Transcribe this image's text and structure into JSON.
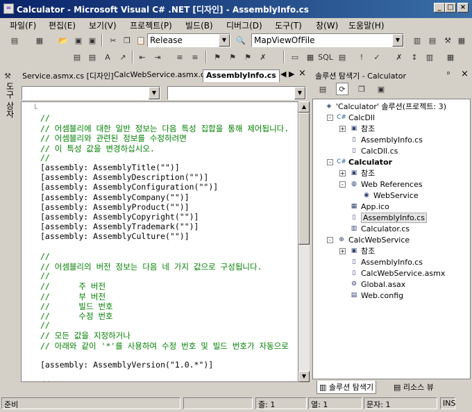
{
  "window": {
    "title": "Calculator - Microsoft Visual C# .NET [디자인] - AssemblyInfo.cs",
    "min": "_",
    "max": "□",
    "close": "×"
  },
  "menu": [
    "파일(F)",
    "편집(E)",
    "보기(V)",
    "프로젝트(P)",
    "빌드(B)",
    "디버그(D)",
    "도구(T)",
    "창(W)",
    "도움말(H)"
  ],
  "toolbar": {
    "config": "Release",
    "find": "MapViewOfFile"
  },
  "toolbox": {
    "label": "도구 상자"
  },
  "editor": {
    "tabs": [
      "Service.asmx.cs [디자인]",
      "CalcWebService.asmx.cs",
      "AssemblyInfo.cs"
    ],
    "lines": [
      {
        "t": "//",
        "c": true
      },
      {
        "t": "// 어셈블리에 대한 일반 정보는 다음 특성 집합을 통해 제어됩니다.",
        "c": true
      },
      {
        "t": "// 어셈블리와 관련된 정보를 수정하려면",
        "c": true
      },
      {
        "t": "// 이 특성 값을 변경하십시오.",
        "c": true
      },
      {
        "t": "//",
        "c": true
      },
      {
        "t": "[assembly: AssemblyTitle(\"\")]",
        "c": false
      },
      {
        "t": "[assembly: AssemblyDescription(\"\")]",
        "c": false
      },
      {
        "t": "[assembly: AssemblyConfiguration(\"\")]",
        "c": false
      },
      {
        "t": "[assembly: AssemblyCompany(\"\")]",
        "c": false
      },
      {
        "t": "[assembly: AssemblyProduct(\"\")]",
        "c": false
      },
      {
        "t": "[assembly: AssemblyCopyright(\"\")]",
        "c": false
      },
      {
        "t": "[assembly: AssemblyTrademark(\"\")]",
        "c": false
      },
      {
        "t": "[assembly: AssemblyCulture(\"\")]",
        "c": false
      },
      {
        "t": "",
        "c": false
      },
      {
        "t": "//",
        "c": true
      },
      {
        "t": "// 어셈블리의 버전 정보는 다음 네 가지 값으로 구성됩니다.",
        "c": true
      },
      {
        "t": "//",
        "c": true
      },
      {
        "t": "//      주 버전",
        "c": true
      },
      {
        "t": "//      부 버전",
        "c": true
      },
      {
        "t": "//      빌드 번호",
        "c": true
      },
      {
        "t": "//      수정 번호",
        "c": true
      },
      {
        "t": "//",
        "c": true
      },
      {
        "t": "// 모든 값을 지정하거나",
        "c": true
      },
      {
        "t": "// 아래와 같이 '*'를 사용하여 수정 번호 및 빌드 번호가 자동으로",
        "c": true
      },
      {
        "t": "",
        "c": false
      },
      {
        "t": "[assembly: AssemblyVersion(\"1.0.*\")]",
        "c": false
      },
      {
        "t": "",
        "c": false
      },
      {
        "t": "//",
        "c": true
      }
    ]
  },
  "solution_explorer": {
    "title": "솔루션 탐색기 - Calculator",
    "pin": "ᵖ",
    "close": "×",
    "nodes": [
      {
        "label": "'Calculator' 솔루션(프로젝트: 3)",
        "icon": "solution-icon",
        "lvl": 0,
        "pm": "",
        "bold": false
      },
      {
        "label": "CalcDll",
        "icon": "csharp-project-icon",
        "lvl": 1,
        "pm": "-",
        "bold": false
      },
      {
        "label": "참조",
        "icon": "references-icon",
        "lvl": 2,
        "pm": "+",
        "bold": false
      },
      {
        "label": "AssemblyInfo.cs",
        "icon": "cs-file-icon",
        "lvl": 2,
        "pm": "",
        "bold": false
      },
      {
        "label": "CalcDll.cs",
        "icon": "cs-file-icon",
        "lvl": 2,
        "pm": "",
        "bold": false
      },
      {
        "label": "Calculator",
        "icon": "csharp-project-icon",
        "lvl": 1,
        "pm": "-",
        "bold": true
      },
      {
        "label": "참조",
        "icon": "references-icon",
        "lvl": 2,
        "pm": "+",
        "bold": false
      },
      {
        "label": "Web References",
        "icon": "web-references-icon",
        "lvl": 2,
        "pm": "-",
        "bold": false
      },
      {
        "label": "WebService",
        "icon": "web-service-icon",
        "lvl": 3,
        "pm": "",
        "bold": false
      },
      {
        "label": "App.ico",
        "icon": "ico-file-icon",
        "lvl": 2,
        "pm": "",
        "bold": false
      },
      {
        "label": "AssemblyInfo.cs",
        "icon": "cs-file-icon",
        "lvl": 2,
        "pm": "",
        "bold": false,
        "selected": true
      },
      {
        "label": "Calculator.cs",
        "icon": "form-file-icon",
        "lvl": 2,
        "pm": "",
        "bold": false
      },
      {
        "label": "CalcWebService",
        "icon": "web-project-icon",
        "lvl": 1,
        "pm": "-",
        "bold": false
      },
      {
        "label": "참조",
        "icon": "references-icon",
        "lvl": 2,
        "pm": "+",
        "bold": false
      },
      {
        "label": "AssemblyInfo.cs",
        "icon": "cs-file-icon",
        "lvl": 2,
        "pm": "",
        "bold": false
      },
      {
        "label": "CalcWebService.asmx",
        "icon": "asmx-file-icon",
        "lvl": 2,
        "pm": "",
        "bold": false
      },
      {
        "label": "Global.asax",
        "icon": "asax-file-icon",
        "lvl": 2,
        "pm": "",
        "bold": false
      },
      {
        "label": "Web.config",
        "icon": "config-file-icon",
        "lvl": 2,
        "pm": "",
        "bold": false
      }
    ],
    "tabs": [
      "솔루션 탐색기",
      "리소스 뷰"
    ]
  },
  "status": {
    "ready": "준비",
    "line": "줄: 1",
    "col": "열: 1",
    "ch": "문자: 1",
    "ins": "INS"
  }
}
